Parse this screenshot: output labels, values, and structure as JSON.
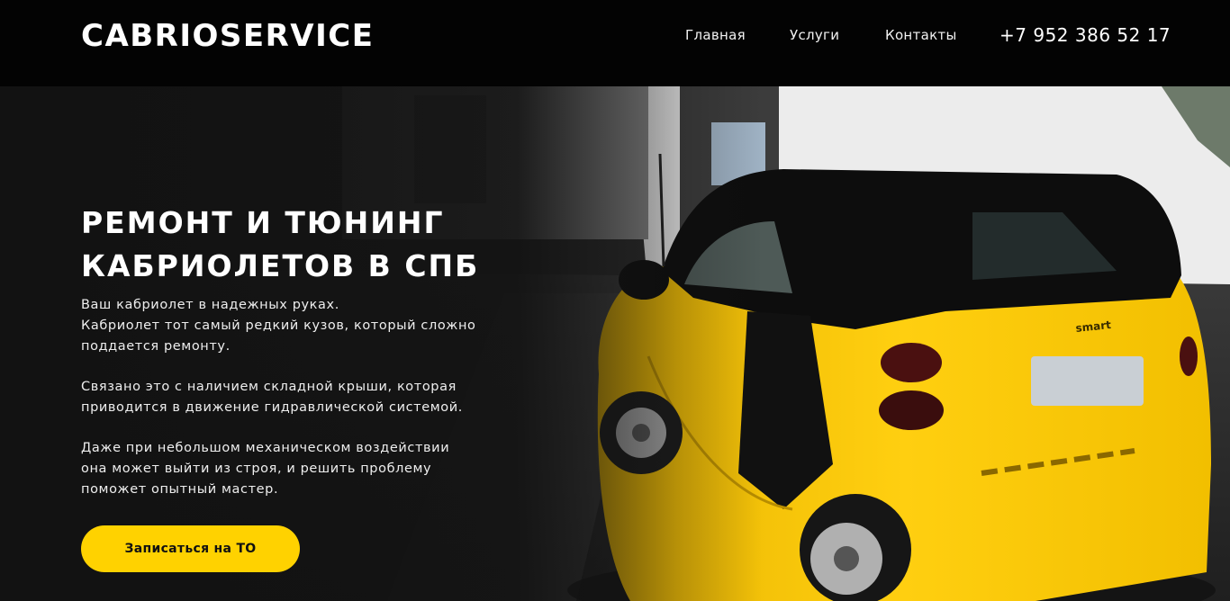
{
  "header": {
    "logo": "CABRIOSERVICE",
    "nav": [
      "Главная",
      "Услуги",
      "Контакты"
    ],
    "phone": "+7 952 386 52 17"
  },
  "hero": {
    "title_lines": [
      "РЕМОНТ И ТЮНИНГ",
      "КАБРИОЛЕТОВ В СПБ"
    ],
    "paragraphs": [
      [
        "Ваш кабриолет в надежных руках.",
        "Кабриолет тот самый редкий кузов, который сложно",
        "поддается ремонту."
      ],
      [
        "Связано это с наличием складной крыши, которая",
        "приводится в движение гидравлической системой."
      ],
      [
        "Даже при небольшом механическом воздействии",
        "она может выйти из строя, и решить проблему",
        "поможет опытный мастер."
      ]
    ],
    "cta_label": "Записаться на ТО",
    "car_badge": "smart"
  },
  "colors": {
    "accent": "#ffd200",
    "header_bg": "#030303",
    "car_yellow": "#f5c000"
  }
}
